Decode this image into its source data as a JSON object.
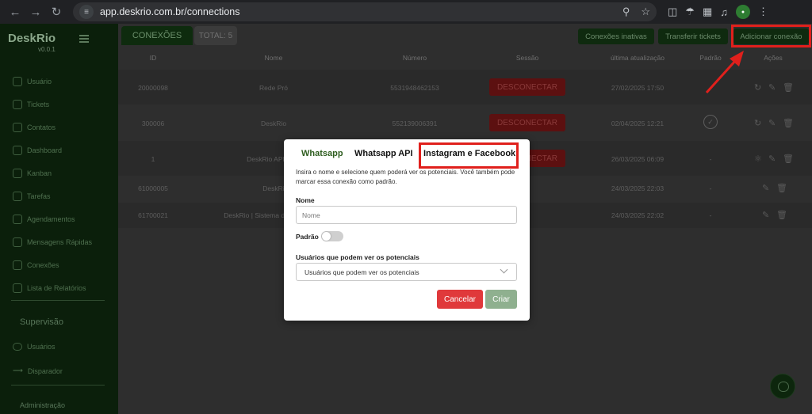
{
  "browser": {
    "url": "app.deskrio.com.br/connections"
  },
  "sidebar": {
    "brand": "DeskRio",
    "version": "v0.0.1",
    "items": [
      {
        "label": "Usuário",
        "icon": "user-icon"
      },
      {
        "label": "Tickets",
        "icon": "chat-bubble-icon"
      },
      {
        "label": "Contatos",
        "icon": "contacts-icon"
      },
      {
        "label": "Dashboard",
        "icon": "dashboard-icon"
      },
      {
        "label": "Kanban",
        "icon": "kanban-icon"
      },
      {
        "label": "Tarefas",
        "icon": "check-circle-icon"
      },
      {
        "label": "Agendamentos",
        "icon": "calendar-icon"
      },
      {
        "label": "Mensagens Rápidas",
        "icon": "quick-message-icon"
      },
      {
        "label": "Conexões",
        "icon": "connections-icon"
      },
      {
        "label": "Lista de Relatórios",
        "icon": "report-icon"
      }
    ],
    "supervision_heading": "Supervisão",
    "supervision_items": [
      {
        "label": "Usuários",
        "icon": "users-icon"
      },
      {
        "label": "Disparador",
        "icon": "send-arrow-icon"
      }
    ],
    "admin_heading": "Administração"
  },
  "header": {
    "tab_label": "CONEXÕES",
    "total_label": "TOTAL: 5",
    "inactive_button": "Conexões inativas",
    "transfer_button": "Transferir tickets",
    "add_button": "Adicionar conexão"
  },
  "table": {
    "columns": [
      "ID",
      "Nome",
      "Número",
      "Sessão",
      "última atualização",
      "Padrão",
      "Ações"
    ],
    "rows": [
      {
        "id": "20000098",
        "name": "Rede Pró",
        "number": "5531948462153",
        "session": "DESCONECTAR",
        "updated": "27/02/2025 17:50",
        "default": "-"
      },
      {
        "id": "300006",
        "name": "DeskRio",
        "number": "552139006391",
        "session": "DESCONECTAR",
        "updated": "02/04/2025 12:21",
        "default": "check"
      },
      {
        "id": "1",
        "name": "DeskRio API",
        "number": "",
        "session": "DESCONECTAR",
        "updated": "26/03/2025 06:09",
        "default": "-"
      },
      {
        "id": "61000005",
        "name": "DeskRi",
        "number": "",
        "session": "",
        "updated": "24/03/2025 22:03",
        "default": "-"
      },
      {
        "id": "61700021",
        "name": "DeskRio | Sistema de",
        "number": "",
        "session": "",
        "updated": "24/03/2025 22:02",
        "default": "-"
      }
    ]
  },
  "modal": {
    "tabs": [
      "Whatsapp",
      "Whatsapp API",
      "Instagram e Facebook"
    ],
    "description": "Insira o nome e selecione quem poderá ver os potenciais. Você também pode marcar essa conexão como padrão.",
    "name_label": "Nome",
    "name_placeholder": "Nome",
    "default_label": "Padrão",
    "users_label": "Usuários que podem ver os potenciais",
    "users_placeholder": "Usuários que podem ver os potenciais",
    "cancel_label": "Cancelar",
    "create_label": "Criar"
  },
  "colors": {
    "brand_green": "#0b1f0b",
    "highlight_red": "#e0201c",
    "cancel_red": "#e0393b",
    "create_green": "#8fb08f"
  }
}
